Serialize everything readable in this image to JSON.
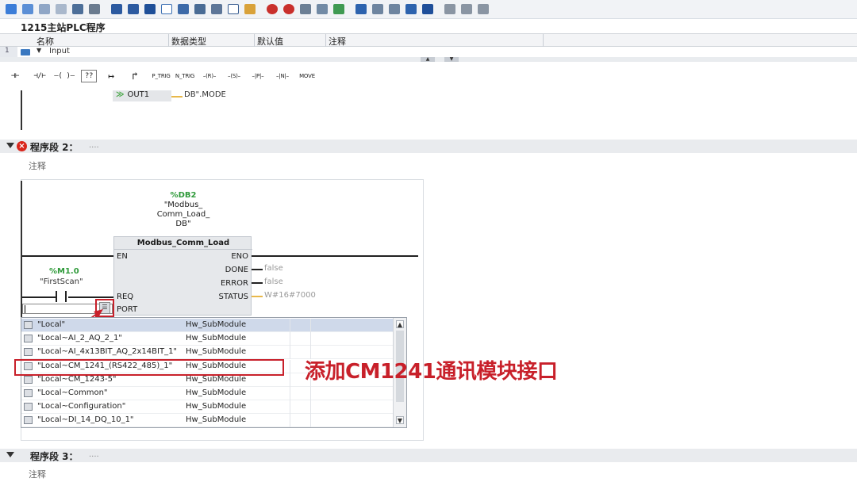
{
  "block": {
    "title": "1215主站PLC程序"
  },
  "interface": {
    "columns": [
      "名称",
      "数据类型",
      "默认值",
      "注释"
    ],
    "row": {
      "number": "1",
      "name": "Input"
    }
  },
  "lad_toolbar": {
    "items": [
      "⊣⊢",
      "⊣/⊢",
      "–( )–",
      "??",
      "↦",
      "↱",
      "P_TRIG",
      "N_TRIG",
      "–(R)–",
      "–(S)–",
      "–|P|–",
      "–|N|–",
      "MOVE"
    ]
  },
  "network1": {
    "out_pin": "OUT1",
    "out_value": "DB\".MODE"
  },
  "network2": {
    "title": "程序段 2：",
    "dots": "....",
    "comment": "注释",
    "db": {
      "address": "%DB2",
      "name": "\"Modbus_\nComm_Load_\nDB\""
    },
    "block_name": "Modbus_Comm_Load",
    "pins": {
      "en": "EN",
      "eno": "ENO",
      "done": "DONE",
      "error": "ERROR",
      "req": "REQ",
      "status": "STATUS",
      "port": "PORT"
    },
    "values": {
      "done": "false",
      "error": "false",
      "status": "W#16#7000"
    },
    "contact": {
      "address": "%M1.0",
      "symbol": "\"FirstScan\""
    },
    "dropdown": [
      {
        "name": "\"Local\"",
        "type": "Hw_SubModule",
        "selected": true
      },
      {
        "name": "\"Local~AI_2_AQ_2_1\"",
        "type": "Hw_SubModule"
      },
      {
        "name": "\"Local~AI_4x13BIT_AQ_2x14BIT_1\"",
        "type": "Hw_SubModule"
      },
      {
        "name": "\"Local~CM_1241_(RS422_485)_1\"",
        "type": "Hw_SubModule"
      },
      {
        "name": "\"Local~CM_1243-5\"",
        "type": "Hw_SubModule"
      },
      {
        "name": "\"Local~Common\"",
        "type": "Hw_SubModule"
      },
      {
        "name": "\"Local~Configuration\"",
        "type": "Hw_SubModule"
      },
      {
        "name": "\"Local~DI_14_DQ_10_1\"",
        "type": "Hw_SubModule"
      }
    ],
    "annotation": "添加CM1241通讯模块接口"
  },
  "network3": {
    "title": "程序段 3：",
    "dots": "....",
    "comment": "注释"
  },
  "colors": {
    "accent_red": "#c8202a",
    "tag_green": "#2f9a3a",
    "error_red": "#d9261c"
  },
  "toolbar_icons": [
    "network-insert-icon",
    "network-delete-icon",
    "open-all-icon",
    "close-all-icon",
    "toggle-icon",
    "absolute-address-icon",
    "list-icon",
    "list2-icon",
    "list3-icon",
    "comment-icon",
    "expand-icon",
    "symbol-icon",
    "symbol2-icon",
    "list4-icon",
    "monitor-icon",
    "error-icon",
    "goto-icon",
    "browse-icon",
    "download-icon",
    "compare-icon",
    "step-icon",
    "step2-icon",
    "force-icon",
    "force2-icon",
    "glasses-icon",
    "lock-icon"
  ]
}
